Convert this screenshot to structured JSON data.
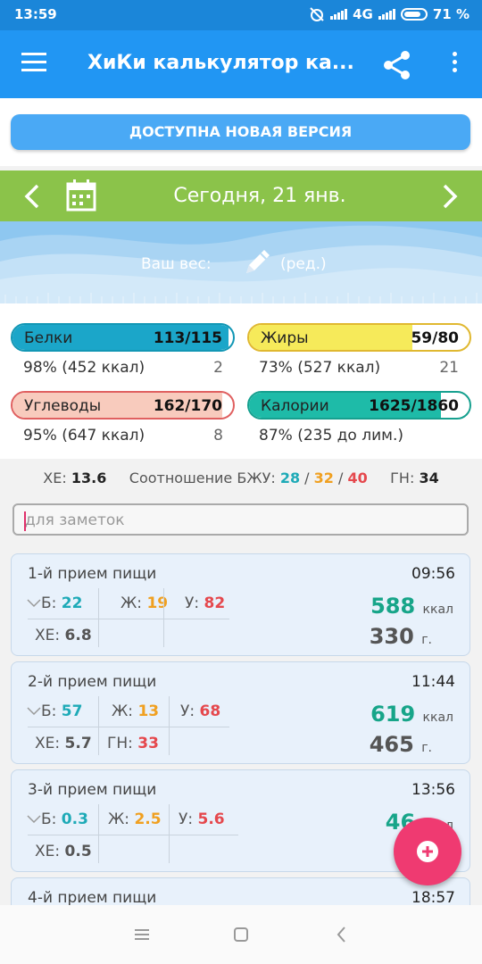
{
  "status_bar": {
    "time": "13:59",
    "network": "4G",
    "battery": "71 %"
  },
  "app_bar": {
    "title": "ХиКи калькулятор ка..."
  },
  "update_button": "ДОСТУПНА НОВАЯ ВЕРСИЯ",
  "date_bar": {
    "date": "Сегодня, 21 янв."
  },
  "weight": {
    "label": "Ваш вес:",
    "edit": "(ред.)"
  },
  "nutrients": {
    "protein": {
      "name": "Белки",
      "value": "113/115",
      "percent_kcal": "98% (452 ккал)",
      "count": "2",
      "fill": 0.98,
      "color": "#1ba6c9"
    },
    "fat": {
      "name": "Жиры",
      "value": "59/80",
      "percent_kcal": "73% (527 ккал)",
      "count": "21",
      "fill": 0.74,
      "color": "#f6ea5a"
    },
    "carbs": {
      "name": "Углеводы",
      "value": "162/170",
      "percent_kcal": "95% (647 ккал)",
      "count": "8",
      "fill": 0.95,
      "color": "#f8cbbd"
    },
    "calories": {
      "name": "Калории",
      "value": "1625/1860",
      "percent_kcal": "87% (235 до лим.)",
      "count": "",
      "fill": 0.87,
      "color": "#1ebba8"
    }
  },
  "summary": {
    "xe_label": "ХЕ:",
    "xe_value": "13.6",
    "ratio_label": "Соотношение БЖУ:",
    "ratio_b": "28",
    "sep1": " / ",
    "ratio_f": "32",
    "sep2": " / ",
    "ratio_c": "40",
    "gn_label": "ГН:",
    "gn_value": "34"
  },
  "notes_placeholder": "для заметок",
  "meals": [
    {
      "title": "1-й прием пищи",
      "time": "09:56",
      "b_label": "Б:",
      "b": "22",
      "f_label": "Ж:",
      "f": "19",
      "c_label": "У:",
      "c": "82",
      "xe_label": "ХЕ:",
      "xe": "6.8",
      "gn_label": "",
      "gn": "",
      "kcal": "588",
      "kcal_unit": "ккал",
      "grams": "330",
      "grams_unit": "г."
    },
    {
      "title": "2-й прием пищи",
      "time": "11:44",
      "b_label": "Б:",
      "b": "57",
      "f_label": "Ж:",
      "f": "13",
      "c_label": "У:",
      "c": "68",
      "xe_label": "ХЕ:",
      "xe": "5.7",
      "gn_label": "ГН:",
      "gn": "33",
      "kcal": "619",
      "kcal_unit": "ккал",
      "grams": "465",
      "grams_unit": "г."
    },
    {
      "title": "3-й прием пищи",
      "time": "13:56",
      "b_label": "Б:",
      "b": "0.3",
      "f_label": "Ж:",
      "f": "2.5",
      "c_label": "У:",
      "c": "5.6",
      "xe_label": "ХЕ:",
      "xe": "0.5",
      "gn_label": "",
      "gn": "",
      "kcal": "46",
      "kcal_unit": "ккал",
      "grams": "",
      "grams_unit": ""
    },
    {
      "title": "4-й прием пищи",
      "time": "18:57"
    }
  ],
  "colors": {
    "primary": "#2196f3",
    "date_bar": "#8bc34a",
    "fab": "#ef3a71",
    "kcal": "#17a589"
  }
}
